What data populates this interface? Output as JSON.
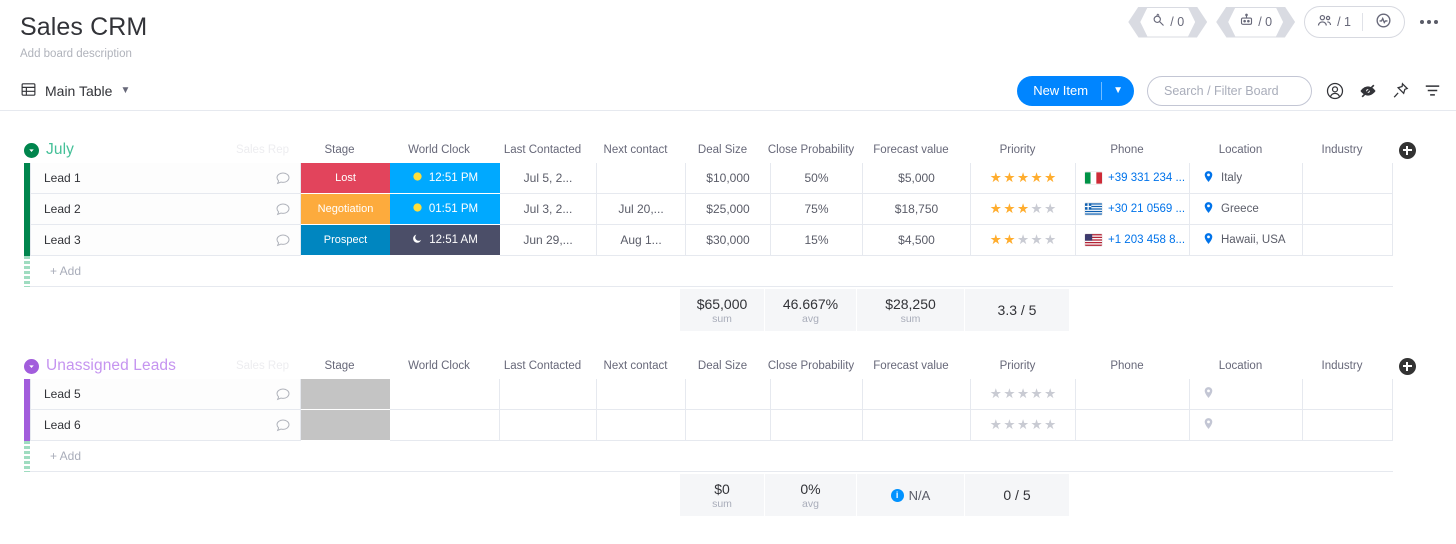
{
  "header": {
    "title": "Sales CRM",
    "description": "Add board description",
    "integrations_count": "/ 0",
    "automations_count": "/ 0",
    "members_count": "/ 1",
    "more_label": "more-options"
  },
  "view_bar": {
    "view_name": "Main Table",
    "new_item_label": "New Item",
    "search_placeholder": "Search / Filter Board",
    "search_value": ""
  },
  "columns": [
    {
      "key": "name",
      "label": ""
    },
    {
      "key": "stage",
      "label": "Stage"
    },
    {
      "key": "clock",
      "label": "World Clock"
    },
    {
      "key": "last",
      "label": "Last Contacted"
    },
    {
      "key": "next",
      "label": "Next contact"
    },
    {
      "key": "deal",
      "label": "Deal Size"
    },
    {
      "key": "prob",
      "label": "Close Probability"
    },
    {
      "key": "fore",
      "label": "Forecast value"
    },
    {
      "key": "prio",
      "label": "Priority"
    },
    {
      "key": "phone",
      "label": "Phone"
    },
    {
      "key": "loc",
      "label": "Location"
    },
    {
      "key": "ind",
      "label": "Industry"
    }
  ],
  "sales_rep_placeholder": "Sales Rep",
  "add_row_label": "+ Add",
  "groups": [
    {
      "name": "July",
      "color": "#00854d",
      "title_color": "#45c098",
      "items": [
        {
          "name": "Lead 1",
          "stage": {
            "label": "Lost",
            "color": "#e2445c"
          },
          "clock": {
            "time": "12:51 PM",
            "period": "day",
            "color": "#00a9ff"
          },
          "last_contacted": "Jul 5, 2...",
          "next_contact": "",
          "deal_size": "$10,000",
          "close_probability": "50%",
          "forecast_value": "$5,000",
          "priority": 5,
          "phone": "+39 331 234 ...",
          "flag": "italy",
          "location": "Italy",
          "industry": ""
        },
        {
          "name": "Lead 2",
          "stage": {
            "label": "Negotiation",
            "color": "#fdab3d"
          },
          "clock": {
            "time": "01:51 PM",
            "period": "day",
            "color": "#00a9ff"
          },
          "last_contacted": "Jul 3, 2...",
          "next_contact": "Jul 20,...",
          "deal_size": "$25,000",
          "close_probability": "75%",
          "forecast_value": "$18,750",
          "priority": 3,
          "phone": "+30 21 0569 ...",
          "flag": "greece",
          "location": "Greece",
          "industry": ""
        },
        {
          "name": "Lead 3",
          "stage": {
            "label": "Prospect",
            "color": "#0086c0"
          },
          "clock": {
            "time": "12:51 AM",
            "period": "night",
            "color": "#4b4e68"
          },
          "last_contacted": "Jun 29,...",
          "next_contact": "Aug 1...",
          "deal_size": "$30,000",
          "close_probability": "15%",
          "forecast_value": "$4,500",
          "priority": 2,
          "phone": "+1 203 458 8...",
          "flag": "usa",
          "location": "Hawaii, USA",
          "industry": ""
        }
      ],
      "summary": {
        "deal_size": {
          "value": "$65,000",
          "label": "sum"
        },
        "close_probability": {
          "value": "46.667%",
          "label": "avg"
        },
        "forecast_value": {
          "value": "$28,250",
          "label": "sum"
        },
        "priority": {
          "value": "3.3 / 5",
          "label": ""
        }
      }
    },
    {
      "name": "Unassigned Leads",
      "color": "#a25ddc",
      "title_color": "#c594f0",
      "items": [
        {
          "name": "Lead 5",
          "stage": {
            "label": "",
            "color": ""
          },
          "clock": {
            "time": "",
            "period": "",
            "color": ""
          },
          "last_contacted": "",
          "next_contact": "",
          "deal_size": "",
          "close_probability": "",
          "forecast_value": "",
          "priority": 0,
          "phone": "",
          "flag": "",
          "location": "",
          "industry": ""
        },
        {
          "name": "Lead 6",
          "stage": {
            "label": "",
            "color": ""
          },
          "clock": {
            "time": "",
            "period": "",
            "color": ""
          },
          "last_contacted": "",
          "next_contact": "",
          "deal_size": "",
          "close_probability": "",
          "forecast_value": "",
          "priority": 0,
          "phone": "",
          "flag": "",
          "location": "",
          "industry": ""
        }
      ],
      "summary": {
        "deal_size": {
          "value": "$0",
          "label": "sum"
        },
        "close_probability": {
          "value": "0%",
          "label": "avg"
        },
        "forecast_value": {
          "value": "N/A",
          "label": "",
          "info": true
        },
        "priority": {
          "value": "0 / 5",
          "label": ""
        }
      }
    }
  ]
}
